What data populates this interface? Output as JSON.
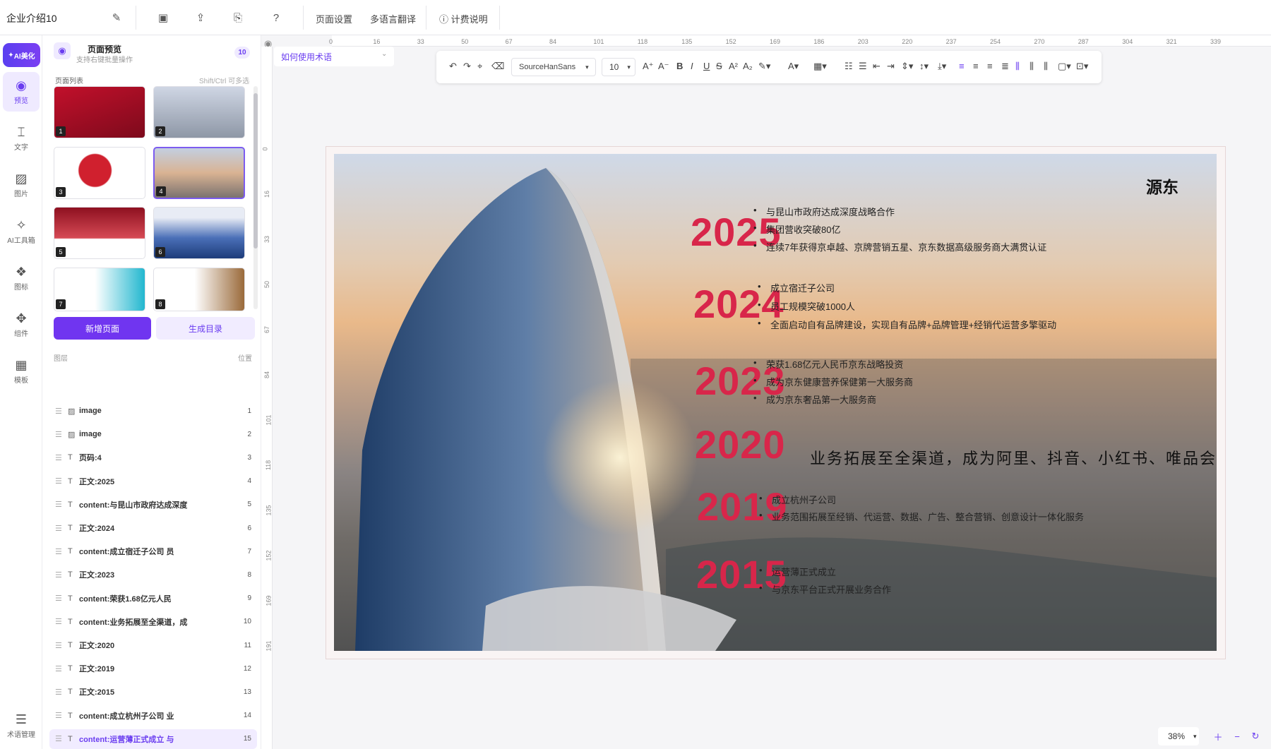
{
  "topbar": {
    "doc_title": "企业介绍10",
    "page_settings": "页面设置",
    "translate": "多语言翻译",
    "billing": "计费说明"
  },
  "nav": {
    "ai_beautify": "AI美化",
    "items": [
      {
        "label": "预览",
        "icon": "eye-icon"
      },
      {
        "label": "文字",
        "icon": "text-icon"
      },
      {
        "label": "图片",
        "icon": "image-icon"
      },
      {
        "label": "AI工具箱",
        "icon": "sparkle-icon"
      },
      {
        "label": "图标",
        "icon": "shapes-icon"
      },
      {
        "label": "组件",
        "icon": "component-icon"
      },
      {
        "label": "模板",
        "icon": "template-icon"
      },
      {
        "label": "术语管理",
        "icon": "glossary-icon"
      }
    ]
  },
  "panel": {
    "title": "页面预览",
    "subtitle": "支持右键批量操作",
    "count": "10",
    "list_label": "页面列表",
    "multi_hint": "Shift/Ctrl 可多选",
    "add_page": "新增页面",
    "gen_toc": "生成目录",
    "layers_label": "图层",
    "pos_label": "位置",
    "thumbs": [
      "1",
      "2",
      "3",
      "4",
      "5",
      "6",
      "7",
      "8"
    ],
    "layers": [
      {
        "type": "image",
        "name": "image",
        "idx": "1"
      },
      {
        "type": "image",
        "name": "image",
        "idx": "2"
      },
      {
        "type": "text",
        "name": "页码:4",
        "idx": "3"
      },
      {
        "type": "text",
        "name": "正文:2025",
        "idx": "4"
      },
      {
        "type": "text",
        "name": "content:与昆山市政府达成深度",
        "idx": "5"
      },
      {
        "type": "text",
        "name": "正文:2024",
        "idx": "6"
      },
      {
        "type": "text",
        "name": "content:成立宿迁子公司 员",
        "idx": "7"
      },
      {
        "type": "text",
        "name": "正文:2023",
        "idx": "8"
      },
      {
        "type": "text",
        "name": "content:荣获1.68亿元人民",
        "idx": "9"
      },
      {
        "type": "text",
        "name": "content:业务拓展至全渠道，成",
        "idx": "10"
      },
      {
        "type": "text",
        "name": "正文:2020",
        "idx": "11"
      },
      {
        "type": "text",
        "name": "正文:2019",
        "idx": "12"
      },
      {
        "type": "text",
        "name": "正文:2015",
        "idx": "13"
      },
      {
        "type": "text",
        "name": "content:成立杭州子公司 业",
        "idx": "14"
      },
      {
        "type": "text",
        "name": "content:运营薄正式成立 与",
        "idx": "15"
      }
    ]
  },
  "editor": {
    "howto": "如何使用术语",
    "font": "SourceHanSans",
    "font_size": "10",
    "zoom": "38%",
    "h_ticks": [
      "0",
      "16",
      "33",
      "50",
      "67",
      "84",
      "101",
      "118",
      "135",
      "152",
      "169",
      "186",
      "203",
      "220",
      "237",
      "254",
      "270",
      "287",
      "304",
      "321",
      "339"
    ],
    "v_ticks": [
      "0",
      "16",
      "33",
      "50",
      "67",
      "84",
      "101",
      "118",
      "135",
      "152",
      "169",
      "191"
    ]
  },
  "slide": {
    "corner_text": "源东",
    "years": [
      "2025",
      "2024",
      "2023",
      "2020",
      "2019",
      "2015"
    ],
    "y2025": [
      "与昆山市政府达成深度战略合作",
      "集团营收突破80亿",
      "连续7年获得京卓越、京牌营销五星、京东数据高级服务商大满贯认证"
    ],
    "y2024": [
      "成立宿迁子公司",
      "员工规模突破1000人",
      "全面启动自有品牌建设，实现自有品牌+品牌管理+经销代运营多擎驱动"
    ],
    "y2023": [
      "荣获1.68亿元人民币京东战略投资",
      "成为京东健康营养保健第一大服务商",
      "成为京东奢品第一大服务商"
    ],
    "y2020": "业务拓展至全渠道，成为阿里、抖音、小红书、唯品会官",
    "y2019": [
      "成立杭州子公司",
      "业务范围拓展至经销、代运营、数据、广告、整合营销、创意设计一体化服务"
    ],
    "y2015": [
      "运营薄正式成立",
      "与京东平台正式开展业务合作"
    ]
  },
  "colors": {
    "accent": "#7035f0",
    "year_red": "#d8264a"
  }
}
